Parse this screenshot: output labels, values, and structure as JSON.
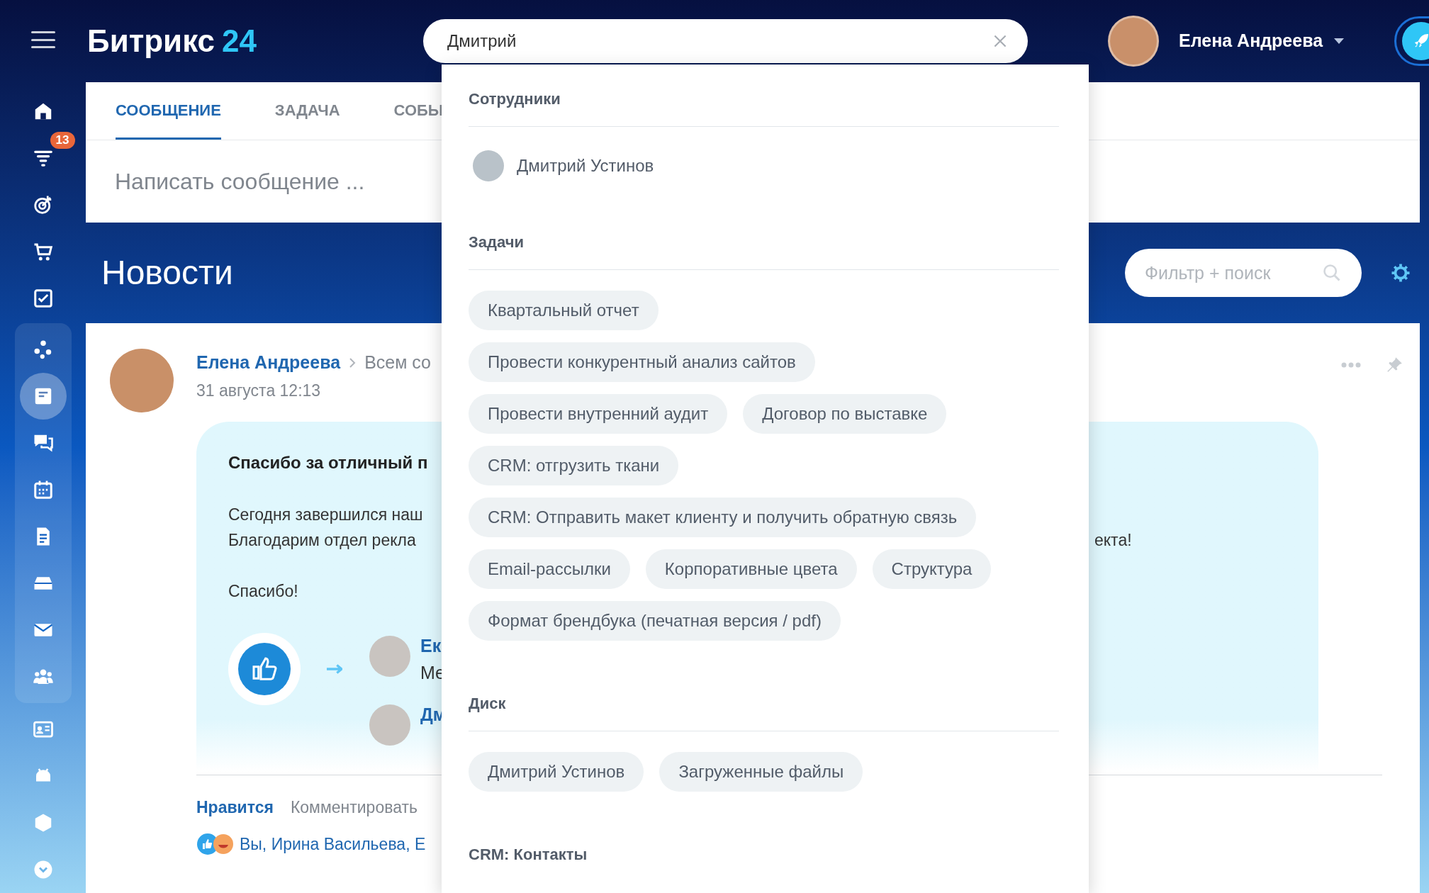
{
  "sidebar": {
    "items": [
      {
        "selected": false
      },
      {
        "selected": false,
        "badge": "13"
      },
      {
        "selected": false
      },
      {
        "selected": false
      },
      {
        "selected": false
      }
    ],
    "group_items": [
      {
        "selected": false
      },
      {
        "selected": true
      },
      {
        "selected": false
      },
      {
        "selected": false
      },
      {
        "selected": false
      },
      {
        "selected": false
      },
      {
        "selected": false
      },
      {
        "selected": false
      }
    ],
    "more_items": [
      {
        "selected": false
      },
      {
        "selected": false
      },
      {
        "selected": false
      },
      {
        "selected": false
      }
    ]
  },
  "header": {
    "logo_text": "Битрикс",
    "logo_number": "24",
    "search": {
      "value": "Дмитрий"
    },
    "user": {
      "name": "Елена Андреева"
    }
  },
  "composer": {
    "tabs": [
      {
        "label": "СООБЩЕНИЕ",
        "selected": true
      },
      {
        "label": "ЗАДАЧА",
        "selected": false
      },
      {
        "label": "СОБЫ",
        "selected": false
      }
    ],
    "placeholder": "Написать сообщение ..."
  },
  "page_title": "Новости",
  "filter": {
    "placeholder": "Фильтр + поиск"
  },
  "post": {
    "author": "Елена Андреева",
    "audience": "Всем со",
    "date": "31 августа 12:13",
    "title": "Спасибо за отличный п",
    "lines": [
      {
        "left": "Сегодня завершился наш"
      },
      {
        "left": "Благодарим отдел рекла",
        "right": "екта!"
      }
    ],
    "closing": "Спасибо!",
    "recipients": [
      {
        "name": "Ек",
        "role": "Ме"
      },
      {
        "name": "Дм"
      }
    ],
    "actions": [
      {
        "label": "Нравится",
        "kind": "like"
      },
      {
        "label": "Комментировать",
        "kind": "comment"
      }
    ],
    "reactions_text": "Вы, Ирина Васильева, Е"
  },
  "search_results": {
    "sections": [
      {
        "title": "Сотрудники",
        "kind": "people",
        "items": [
          "Дмитрий Устинов"
        ]
      },
      {
        "title": "Задачи",
        "kind": "chips",
        "rows": [
          [
            "Квартальный отчет"
          ],
          [
            "Провести конкурентный анализ сайтов"
          ],
          [
            "Провести внутренний аудит",
            "Договор по выставке"
          ],
          [
            "CRM: отгрузить ткани"
          ],
          [
            "CRM: Отправить макет клиенту и получить обратную связь"
          ],
          [
            "Email-рассылки",
            "Корпоративные цвета",
            "Структура"
          ],
          [
            "Формат брендбука (печатная версия / pdf)"
          ]
        ]
      },
      {
        "title": "Диск",
        "kind": "chips",
        "rows": [
          [
            "Дмитрий Устинов",
            "Загруженные файлы"
          ]
        ]
      },
      {
        "title": "CRM: Контакты",
        "kind": "heading"
      }
    ]
  }
}
